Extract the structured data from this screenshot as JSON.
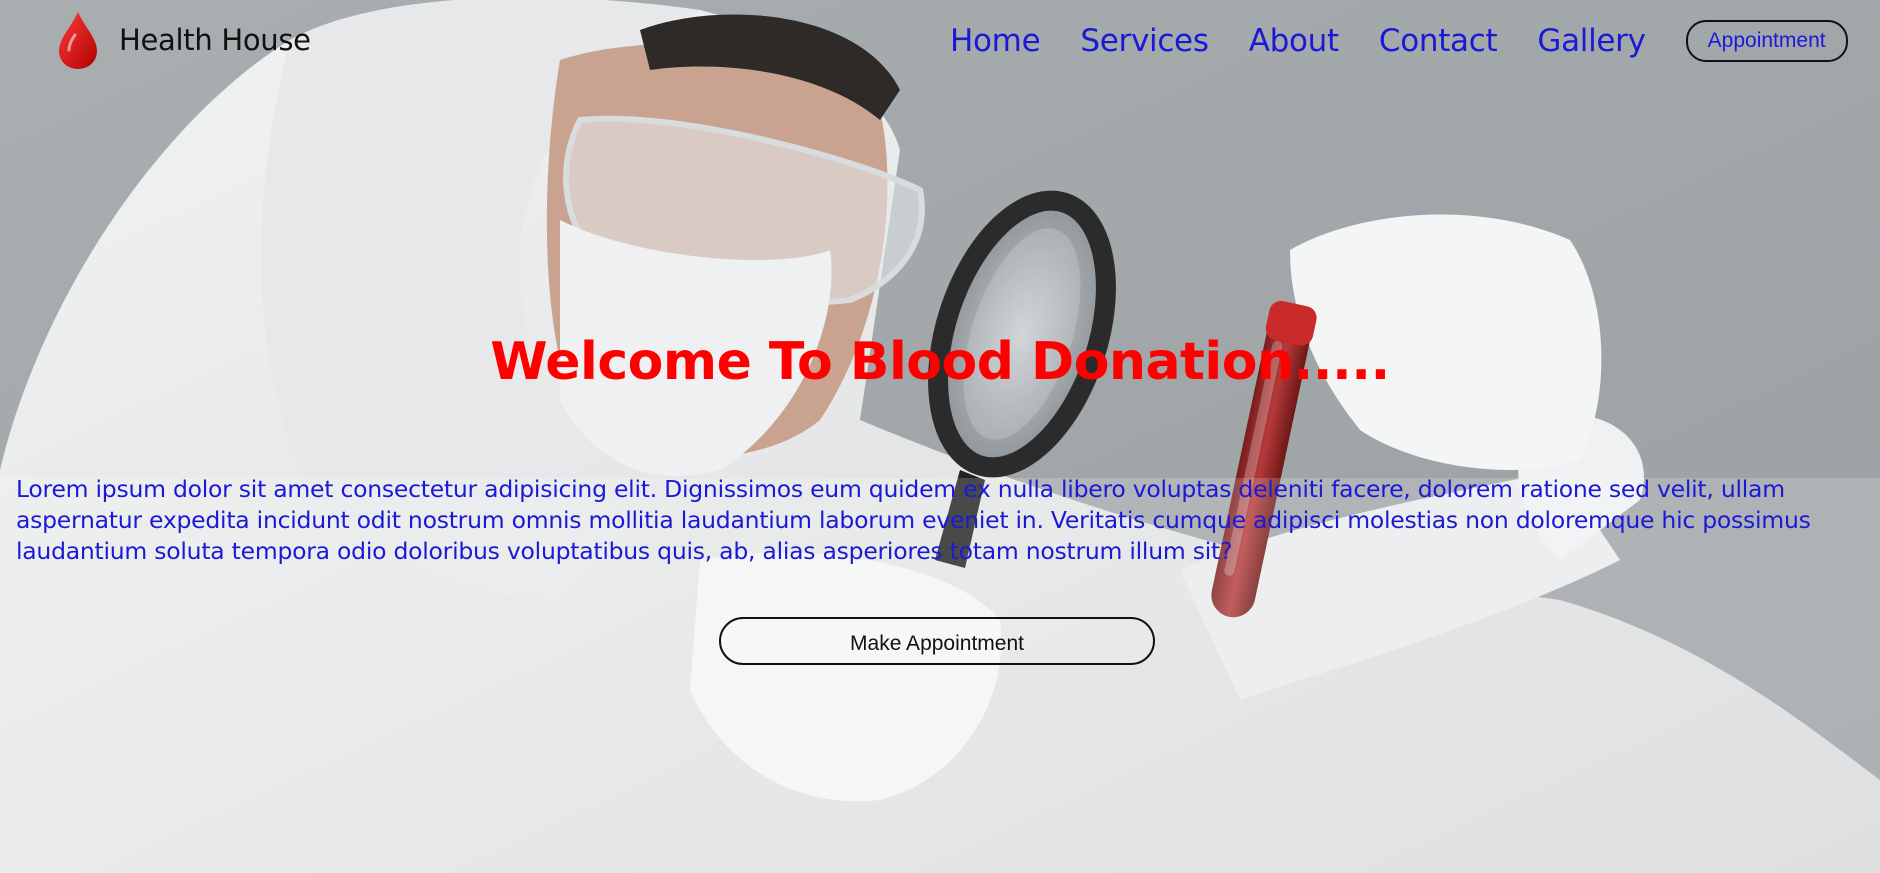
{
  "brand": {
    "name": "Health House",
    "icon": "blood-drop-icon"
  },
  "nav": {
    "links": [
      "Home",
      "Services",
      "About",
      "Contact",
      "Gallery"
    ],
    "appointment_label": "Appointment"
  },
  "hero": {
    "title": "Welcome To Blood Donation.....",
    "description": "Lorem ipsum dolor sit amet consectetur adipisicing elit. Dignissimos eum quidem ex nulla libero voluptas deleniti facere, dolorem ratione sed velit, ullam aspernatur expedita incidunt odit nostrum omnis mollitia laudantium laborum eveniet in. Veritatis cumque adipisci molestias non doloremque hic possimus laudantium soluta tempora odio doloribus voluptatibus quis, ab, alias asperiores totam nostrum illum sit?",
    "cta_label": "Make Appointment",
    "background_image": "lab-technician-with-magnifier-and-blood-tube"
  },
  "colors": {
    "accent_red": "#ff0000",
    "link_blue": "#1a1ad6",
    "text_dark": "#111111",
    "background_gray": "#9aa1a6"
  }
}
